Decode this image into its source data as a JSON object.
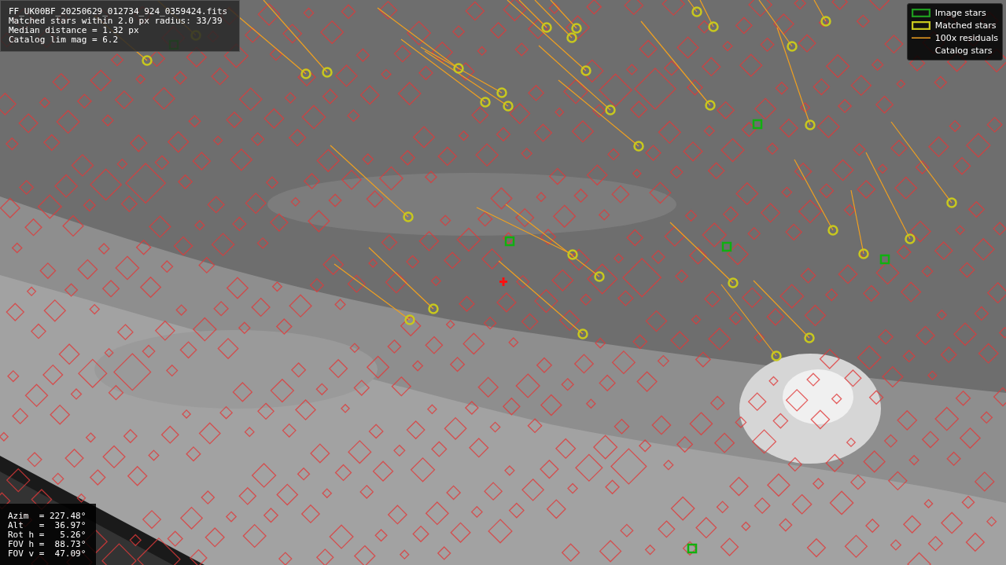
{
  "info": {
    "lines": [
      "FF_UK00BF_20250629_012734_924_0359424.fits",
      "Matched stars within 2.0 px radius: 33/39",
      "Median distance = 1.32 px",
      "Catalog lim mag = 6.2"
    ]
  },
  "legend": [
    {
      "label": "Image stars"
    },
    {
      "kind": "matched",
      "label": "Matched stars"
    },
    {
      "kind": "residual",
      "label": "100x residuals"
    },
    {
      "kind": "catalog",
      "label": "Catalog stars"
    }
  ],
  "pointing": {
    "lines": [
      "Azim  = 227.48°",
      "Alt   =  36.97°",
      "Rot h =   5.26°",
      "FOV h =  88.73°",
      "FOV v =  47.09°"
    ]
  }
}
